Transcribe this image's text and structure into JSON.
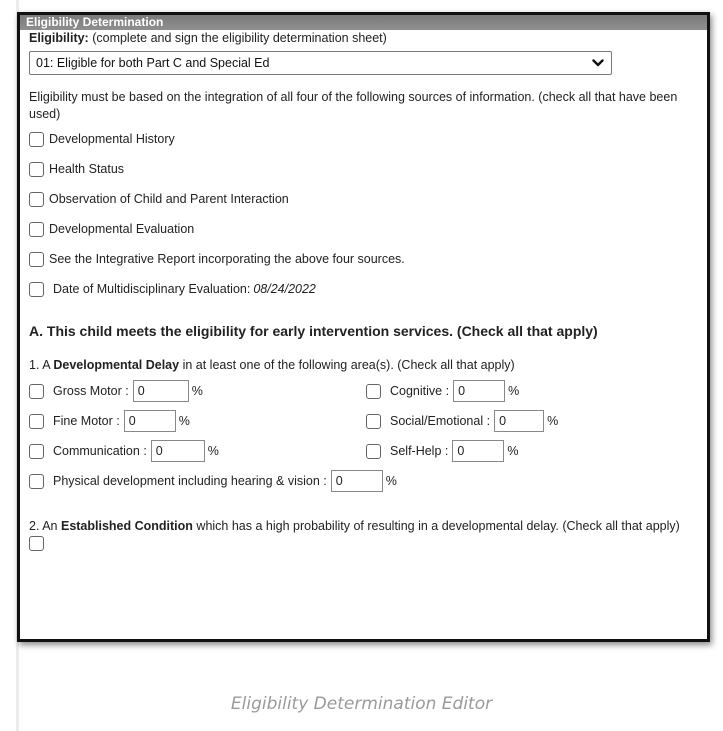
{
  "header": {
    "title": "Eligibility Determination"
  },
  "eligibility": {
    "label": "Eligibility:",
    "note": " (complete and sign the eligibility determination sheet)",
    "selected": "01: Eligible for both Part C and Special Ed"
  },
  "sources": {
    "instructions": "Eligibility must be based on the integration of all four of the following sources of information. (check all that have been used)",
    "items": [
      "Developmental History",
      "Health Status",
      "Observation of Child and Parent Interaction",
      "Developmental Evaluation",
      "See the Integrative Report incorporating the above four sources."
    ],
    "evaluation_date_label": "Date of Multidisciplinary Evaluation: ",
    "evaluation_date": "08/24/2022"
  },
  "section_a": {
    "heading": "A. This child meets the eligibility for early intervention services. (Check all that apply)",
    "delay_prefix": "1. A ",
    "delay_bold": "Developmental Delay",
    "delay_suffix": " in at least one of the following area(s). (Check all that apply)",
    "areas": [
      {
        "label": "Gross Motor : ",
        "value": "0"
      },
      {
        "label": "Cognitive : ",
        "value": "0"
      },
      {
        "label": "Fine Motor : ",
        "value": "0"
      },
      {
        "label": "Social/Emotional : ",
        "value": "0"
      },
      {
        "label": "Communication : ",
        "value": "0"
      },
      {
        "label": "Self-Help : ",
        "value": "0"
      }
    ],
    "physical": {
      "label": "Physical development including hearing & vision : ",
      "value": "0"
    },
    "percent": "%",
    "condition_prefix": "2. An ",
    "condition_bold": "Established Condition",
    "condition_suffix": " which has a high probability of resulting in a developmental delay. (Check all that apply)"
  },
  "caption": "Eligibility Determination Editor"
}
